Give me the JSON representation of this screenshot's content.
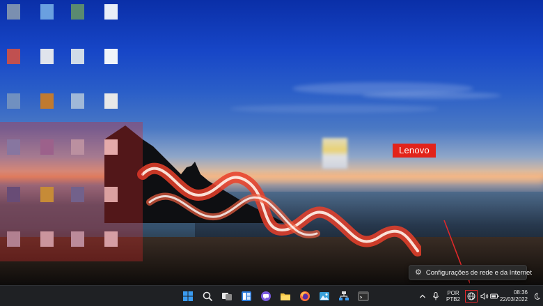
{
  "desktop": {
    "brand_logo": "Lenovo"
  },
  "tooltip": {
    "icon": "gear-icon",
    "text": "Configurações de rede e da Internet"
  },
  "taskbar": {
    "pinned": [
      {
        "name": "start-button",
        "icon": "windows-logo-icon"
      },
      {
        "name": "search-button",
        "icon": "search-icon"
      },
      {
        "name": "task-view-button",
        "icon": "task-view-icon"
      },
      {
        "name": "widgets-button",
        "icon": "widgets-icon"
      },
      {
        "name": "chat-button",
        "icon": "chat-icon"
      },
      {
        "name": "file-explorer-button",
        "icon": "folder-icon"
      },
      {
        "name": "firefox-button",
        "icon": "firefox-icon"
      },
      {
        "name": "photos-button",
        "icon": "photos-icon"
      },
      {
        "name": "network-app-button",
        "icon": "network-app-icon"
      },
      {
        "name": "terminal-button",
        "icon": "terminal-icon"
      }
    ],
    "tray": {
      "language_top": "POR",
      "language_bottom": "PTB2",
      "time": "08:36",
      "date": "22/03/2022"
    }
  },
  "colors": {
    "taskbar_bg": "#1f2124",
    "tooltip_bg": "#2b2b2b",
    "lenovo_red": "#e2231a",
    "annotation_red": "#e0282a"
  }
}
